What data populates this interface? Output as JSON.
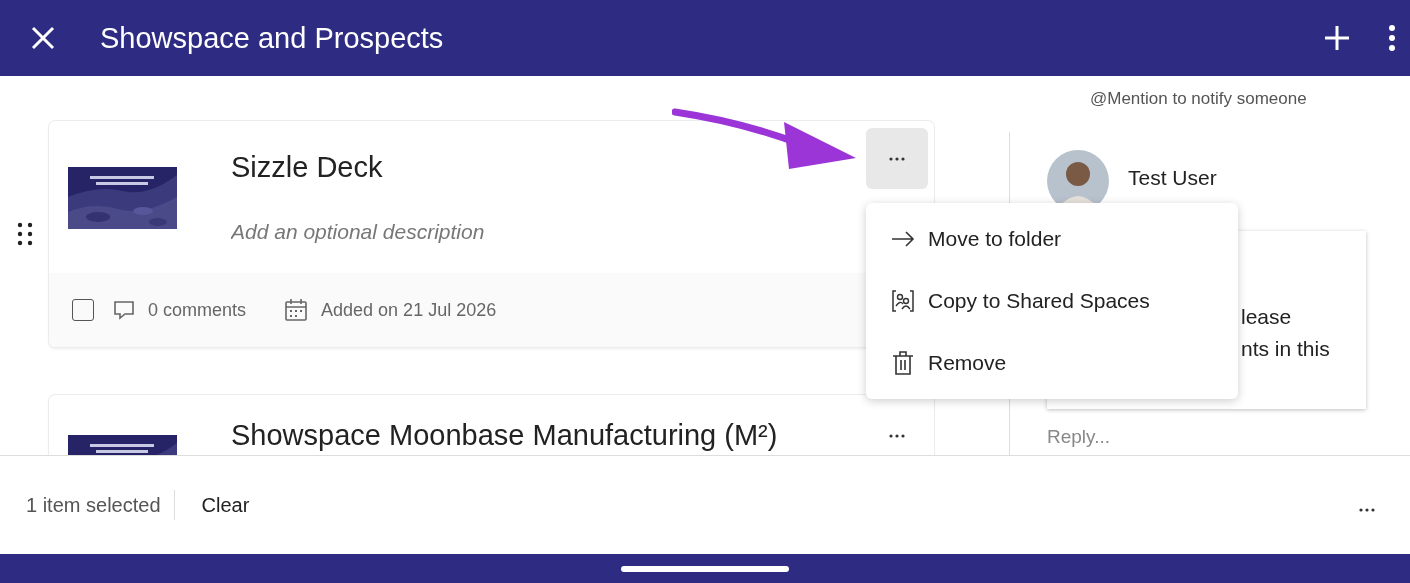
{
  "header": {
    "title": "Showspace and Prospects"
  },
  "cards": [
    {
      "title": "Sizzle Deck",
      "placeholder": "Add an optional description",
      "checked": false,
      "comments": "0 comments",
      "added": "Added on 21 Jul 2026",
      "menu_open": true
    },
    {
      "title": "Showspace Moonbase Manufacturing (M²)",
      "menu_open": false
    }
  ],
  "menu": {
    "items": [
      {
        "kind": "move",
        "label": "Move to folder"
      },
      {
        "kind": "share",
        "label": "Copy to Shared Spaces"
      },
      {
        "kind": "remove",
        "label": "Remove"
      }
    ]
  },
  "comments": {
    "hint": "@Mention to notify someone",
    "user": "Test User",
    "comment_lines": [
      "lease",
      "nts in this"
    ],
    "reply_placeholder": "Reply..."
  },
  "selection_bar": {
    "count": "1 item selected",
    "clear": "Clear"
  }
}
